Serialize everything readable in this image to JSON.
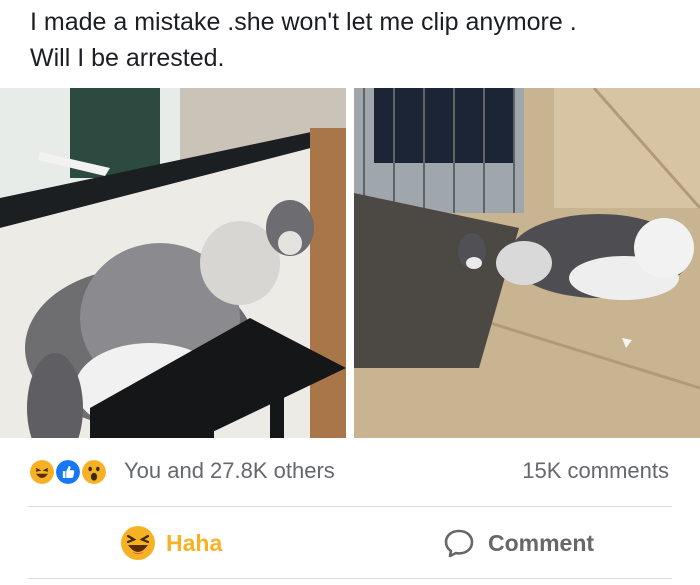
{
  "post": {
    "text_line_1": "I made a mistake .she won't let me clip anymore .",
    "text_line_2": "Will I be arrested."
  },
  "photos": [
    {
      "name": "left-photo-cat-on-stool"
    },
    {
      "name": "right-photo-cat-on-floor"
    }
  ],
  "reactions": {
    "icons": [
      "haha-icon",
      "like-icon",
      "wow-icon"
    ],
    "summary": "You and 27.8K others",
    "comments": "15K comments"
  },
  "actions": {
    "haha_label": "Haha",
    "comment_label": "Comment"
  },
  "colors": {
    "haha": "#f7b125",
    "like": "#1877f2",
    "muted": "#65676b",
    "divider": "#dddfe2"
  }
}
